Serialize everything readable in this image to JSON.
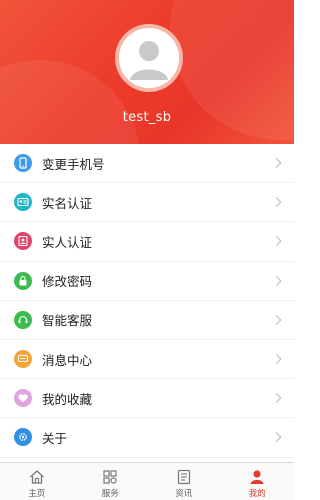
{
  "profile": {
    "username": "test_sb"
  },
  "colors": {
    "header_red": "#ec3b2a",
    "accent": "#e33c2e"
  },
  "menu": [
    {
      "label": "变更手机号",
      "icon": "phone-icon",
      "color": "#3f9be8"
    },
    {
      "label": "实名认证",
      "icon": "id-card-icon",
      "color": "#25b4c9"
    },
    {
      "label": "实人认证",
      "icon": "person-verify-icon",
      "color": "#e0446b"
    },
    {
      "label": "修改密码",
      "icon": "lock-icon",
      "color": "#3dbb4f"
    },
    {
      "label": "智能客服",
      "icon": "customer-service-icon",
      "color": "#3dbb4f"
    },
    {
      "label": "消息中心",
      "icon": "message-icon",
      "color": "#f3a53a"
    },
    {
      "label": "我的收藏",
      "icon": "heart-icon",
      "color": "#e3a3de"
    },
    {
      "label": "关于",
      "icon": "gear-icon",
      "color": "#2f8fe0"
    }
  ],
  "tabbar": [
    {
      "label": "主页",
      "icon": "home-icon",
      "active": false
    },
    {
      "label": "服务",
      "icon": "grid-icon",
      "active": false
    },
    {
      "label": "资讯",
      "icon": "news-icon",
      "active": false
    },
    {
      "label": "我的",
      "icon": "user-icon",
      "active": true
    }
  ]
}
